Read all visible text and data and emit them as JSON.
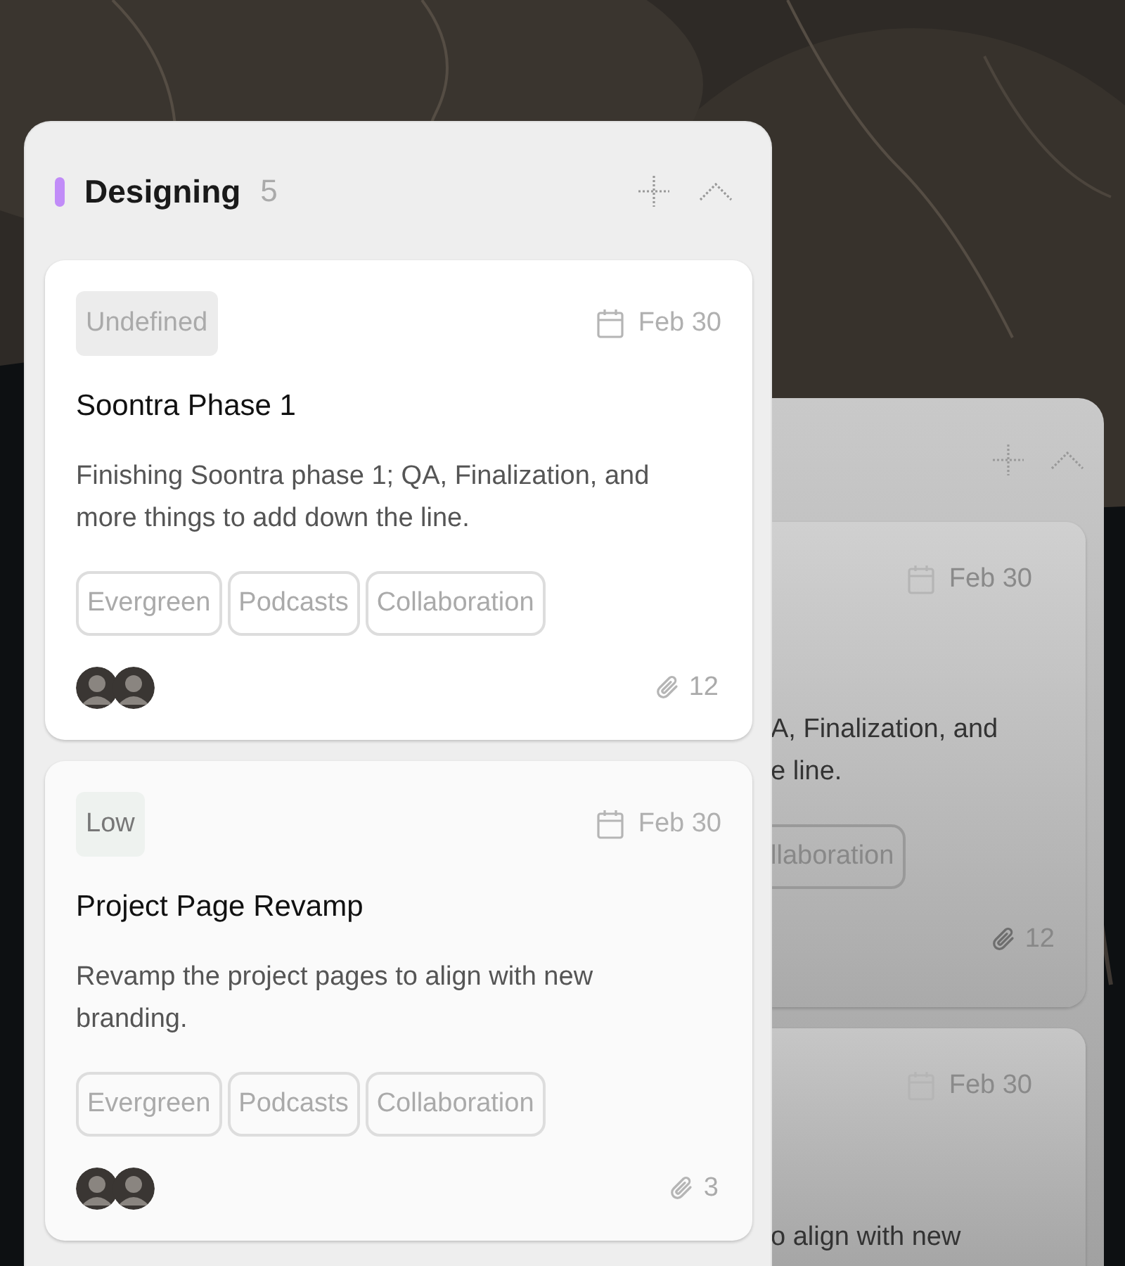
{
  "column": {
    "title": "Designing",
    "count": "5",
    "color": "#c18cf8",
    "cards": [
      {
        "priority": {
          "label": "Undefined",
          "kind": "undefined"
        },
        "date": "Feb 30",
        "title": "Soontra Phase 1",
        "description": "Finishing Soontra phase 1; QA, Finalization, and more things to add down the line.",
        "tags": [
          "Evergreen",
          "Podcasts",
          "Collaboration"
        ],
        "attachments": "12"
      },
      {
        "priority": {
          "label": "Low",
          "kind": "low"
        },
        "date": "Feb 30",
        "title": "Project Page Revamp",
        "description": "Revamp the project pages to align with new branding.",
        "tags": [
          "Evergreen",
          "Podcasts",
          "Collaboration"
        ],
        "attachments": "3"
      }
    ]
  },
  "back_column": {
    "cards": [
      {
        "date": "Feb 30",
        "description_lines": [
          "A, Finalization, and",
          "e line."
        ],
        "tags": [
          "llaboration"
        ],
        "attachments": "12"
      },
      {
        "date": "Feb 30",
        "description_lines": [
          "o align with new"
        ]
      }
    ]
  }
}
